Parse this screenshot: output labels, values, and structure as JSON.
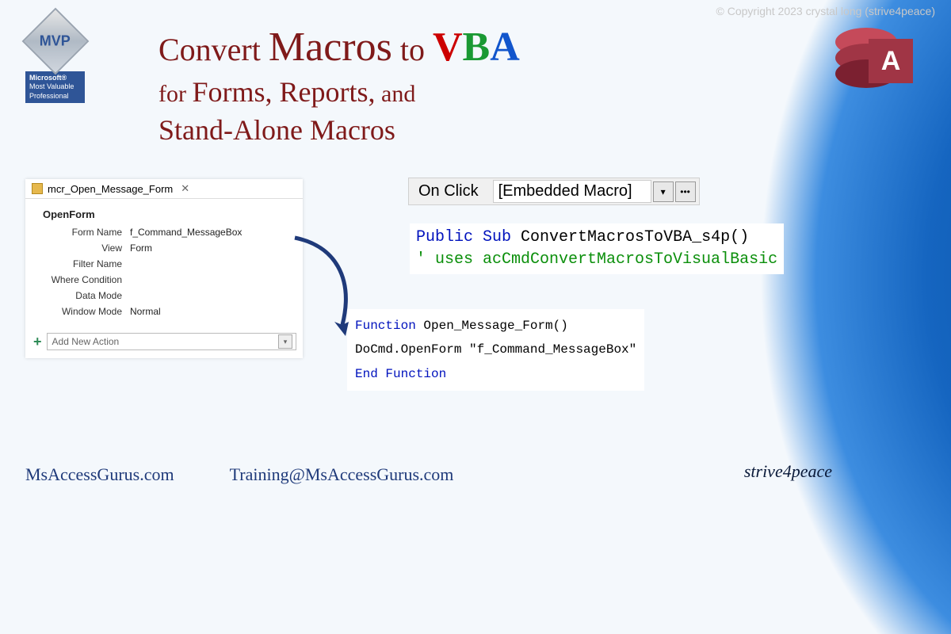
{
  "copyright": "© Copyright 2023 crystal long (strive4peace)",
  "mvp": {
    "acronym": "MVP",
    "line1": "Microsoft®",
    "line2": "Most Valuable",
    "line3": "Professional"
  },
  "access_letter": "A",
  "title": {
    "pre": "Convert ",
    "macros": "Macros",
    "to": " to ",
    "line2a": "for ",
    "line2b": "Forms, Reports,",
    "line2c": " and",
    "line3": "Stand-Alone Macros"
  },
  "macro": {
    "tab_name": "mcr_Open_Message_Form",
    "action": "OpenForm",
    "rows": [
      {
        "label": "Form Name",
        "value": "f_Command_MessageBox"
      },
      {
        "label": "View",
        "value": "Form"
      },
      {
        "label": "Filter Name",
        "value": ""
      },
      {
        "label": "Where Condition",
        "value": ""
      },
      {
        "label": "Data Mode",
        "value": ""
      },
      {
        "label": "Window Mode",
        "value": "Normal"
      }
    ],
    "add_placeholder": "Add New Action"
  },
  "property": {
    "label": "On Click",
    "value": "[Embedded Macro]"
  },
  "vba1": {
    "l1a": "Public Sub",
    "l1b": " ConvertMacrosToVBA_s4p()",
    "l2": "' uses acCmdConvertMacrosToVisualBasic"
  },
  "vba2": {
    "l1a": "Function",
    "l1b": " Open_Message_Form()",
    "l2": "   DoCmd.OpenForm \"f_Command_MessageBox\"",
    "l3": "End Function"
  },
  "footer": {
    "site": "MsAccessGurus.com",
    "email": "Training@MsAccessGurus.com"
  },
  "signature": "strive4peace"
}
